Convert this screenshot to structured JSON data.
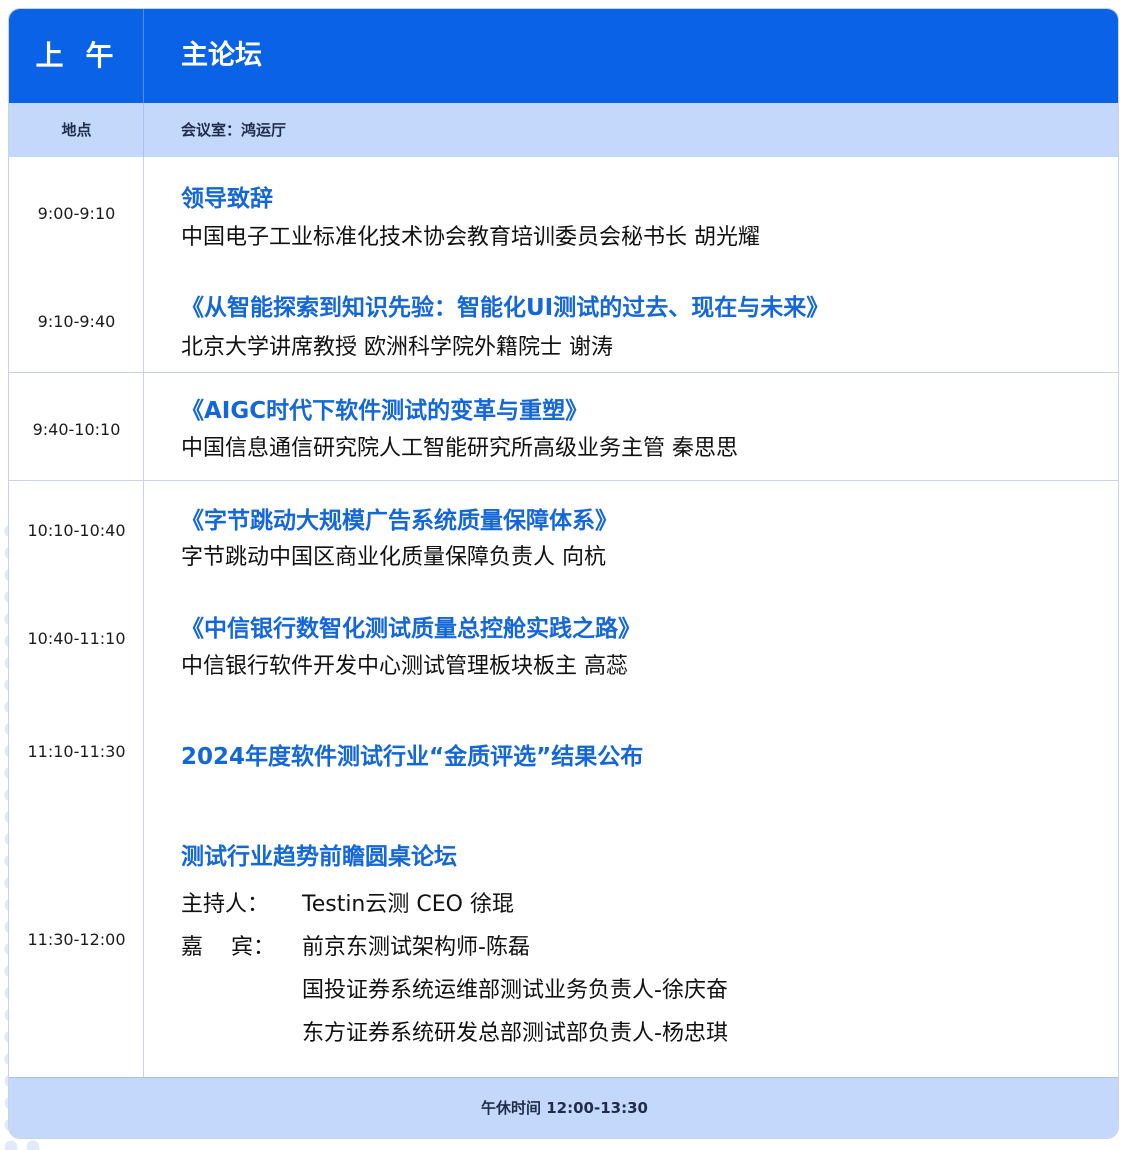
{
  "header": {
    "period": "上午",
    "forum": "主论坛"
  },
  "venue": {
    "label": "地点",
    "value": "会议室：鸿运厅"
  },
  "schedule": [
    {
      "time": "9:00-9:10",
      "title": "领导致辞",
      "speaker": "中国电子工业标准化技术协会教育培训委员会秘书长  胡光耀"
    },
    {
      "time": "9:10-9:40",
      "title": "《从智能探索到知识先验：智能化UI测试的过去、现在与未来》",
      "speaker": "北京大学讲席教授 欧洲科学院外籍院士  谢涛"
    },
    {
      "time": "9:40-10:10",
      "title": "《AIGC时代下软件测试的变革与重塑》",
      "speaker": "中国信息通信研究院人工智能研究所高级业务主管 秦思思"
    },
    {
      "time": "10:10-10:40",
      "title": "《字节跳动大规模广告系统质量保障体系》",
      "speaker": "字节跳动中国区商业化质量保障负责人 向杭"
    },
    {
      "time": "10:40-11:10",
      "title": "《中信银行数智化测试质量总控舱实践之路》",
      "speaker": "中信银行软件开发中心测试管理板块板主 高蕊"
    },
    {
      "time": "11:10-11:30",
      "title": "2024年度软件测试行业“金质评选”结果公布"
    },
    {
      "time": "11:30-12:00",
      "title": "测试行业趋势前瞻圆桌论坛",
      "host_label": "主持人：",
      "host": "Testin云测 CEO  徐琨",
      "guest_label": "嘉    宾：",
      "guests": [
        "前京东测试架构师-陈磊",
        "国投证券系统运维部测试业务负责人-徐庆奋",
        "东方证券系统研发总部测试部负责人-杨忠琪"
      ]
    }
  ],
  "footer": {
    "break": "午休时间 12:00-13:30"
  }
}
